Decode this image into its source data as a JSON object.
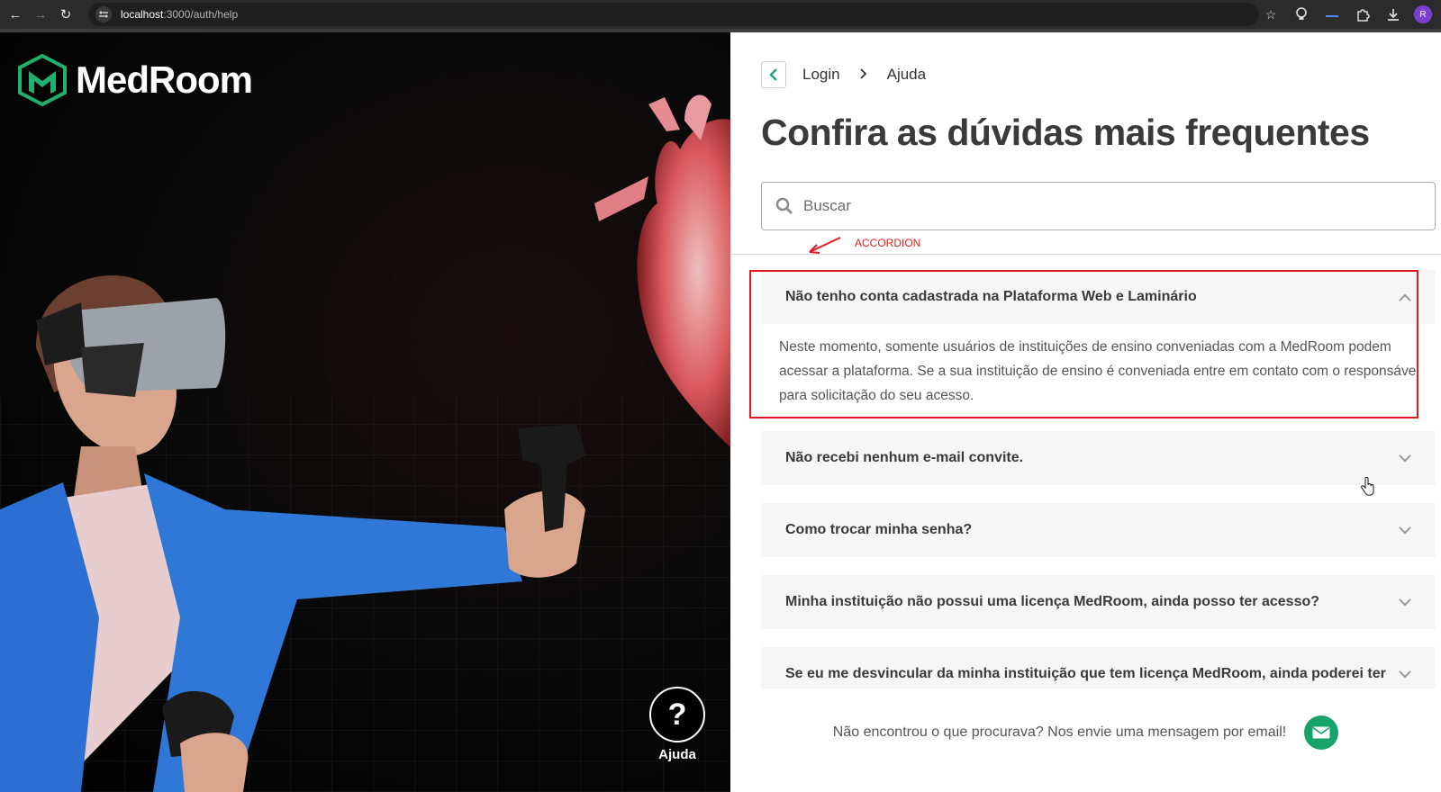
{
  "browser": {
    "url_host": "localhost",
    "url_path": ":3000/auth/help",
    "profile_initial": "R"
  },
  "brand": {
    "name": "MedRoom",
    "accent": "#15a36b"
  },
  "help_fab": {
    "glyph": "?",
    "label": "Ajuda"
  },
  "breadcrumb": {
    "back_icon": "chevron-left-icon",
    "items": [
      "Login",
      "Ajuda"
    ]
  },
  "page": {
    "title": "Confira as dúvidas mais frequentes"
  },
  "search": {
    "placeholder": "Buscar"
  },
  "annotation": {
    "label": "ACCORDION",
    "color": "#e01b24"
  },
  "faq": [
    {
      "question": "Não tenho conta cadastrada na Plataforma Web e Laminário",
      "answer": "Neste momento, somente usuários de instituições de ensino conveniadas com a MedRoom podem acessar a plataforma. Se a sua instituição de ensino é conveniada entre em contato com o responsável para solicitação do seu acesso.",
      "expanded": true
    },
    {
      "question": "Não recebi nenhum e-mail convite.",
      "expanded": false
    },
    {
      "question": "Como trocar minha senha?",
      "expanded": false
    },
    {
      "question": "Minha instituição não possui uma licença MedRoom, ainda posso ter acesso?",
      "expanded": false
    },
    {
      "question": "Se eu me desvincular da minha instituição que tem licença MedRoom, ainda poderei ter",
      "expanded": false
    }
  ],
  "footer": {
    "text": "Não encontrou o que procurava? Nos envie uma mensagem por email!",
    "mail_icon": "envelope-icon"
  }
}
